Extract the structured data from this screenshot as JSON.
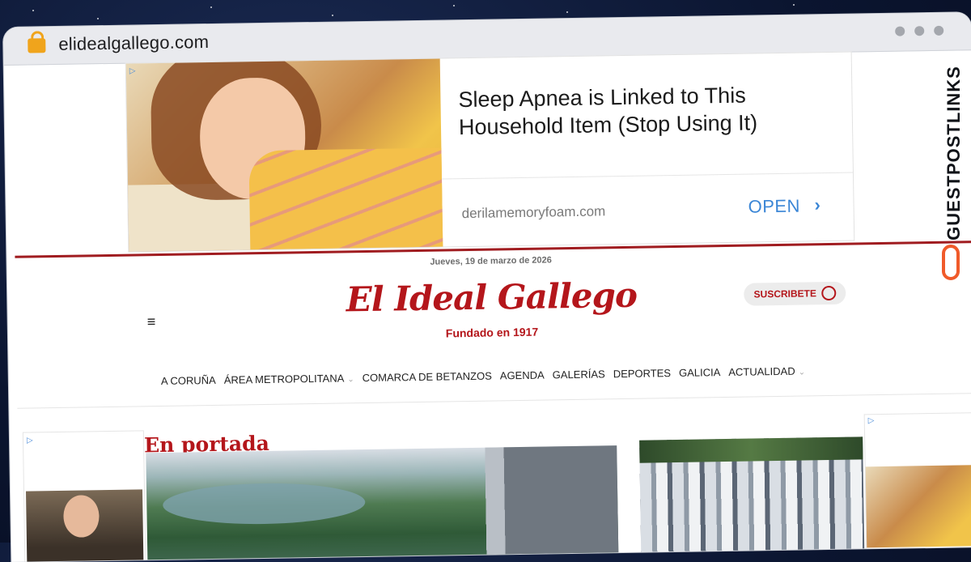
{
  "browser": {
    "url": "elidealgallego.com"
  },
  "ad_banner": {
    "adchoice": "▷",
    "headline": "Sleep Apnea is Linked to This Household Item (Stop Using It)",
    "domain": "derilamemoryfoam.com",
    "cta": "OPEN",
    "cta_icon": "›"
  },
  "header": {
    "date": "Jueves, 19 de marzo de 2026",
    "logo": "El Ideal Gallego",
    "tagline": "Fundado en 1917",
    "subscribe": "SUSCRIBETE",
    "menu_icon": "≡",
    "accent_color": "#b4161b"
  },
  "nav": {
    "items": [
      {
        "label": "A CORUÑA",
        "dropdown": false
      },
      {
        "label": "ÁREA METROPOLITANA",
        "dropdown": true
      },
      {
        "label": "COMARCA DE BETANZOS",
        "dropdown": false
      },
      {
        "label": "AGENDA",
        "dropdown": false
      },
      {
        "label": "GALERÍAS",
        "dropdown": false
      },
      {
        "label": "DEPORTES",
        "dropdown": false
      },
      {
        "label": "GALICIA",
        "dropdown": false
      },
      {
        "label": "ACTUALIDAD",
        "dropdown": true
      }
    ],
    "chevron": "⌄"
  },
  "main": {
    "section_title": "En portada"
  },
  "side_ad": {
    "adchoice": "▷"
  },
  "right_ad": {
    "adchoice": "▷"
  },
  "brand_watermark": "GUESTPOSTLINKS"
}
